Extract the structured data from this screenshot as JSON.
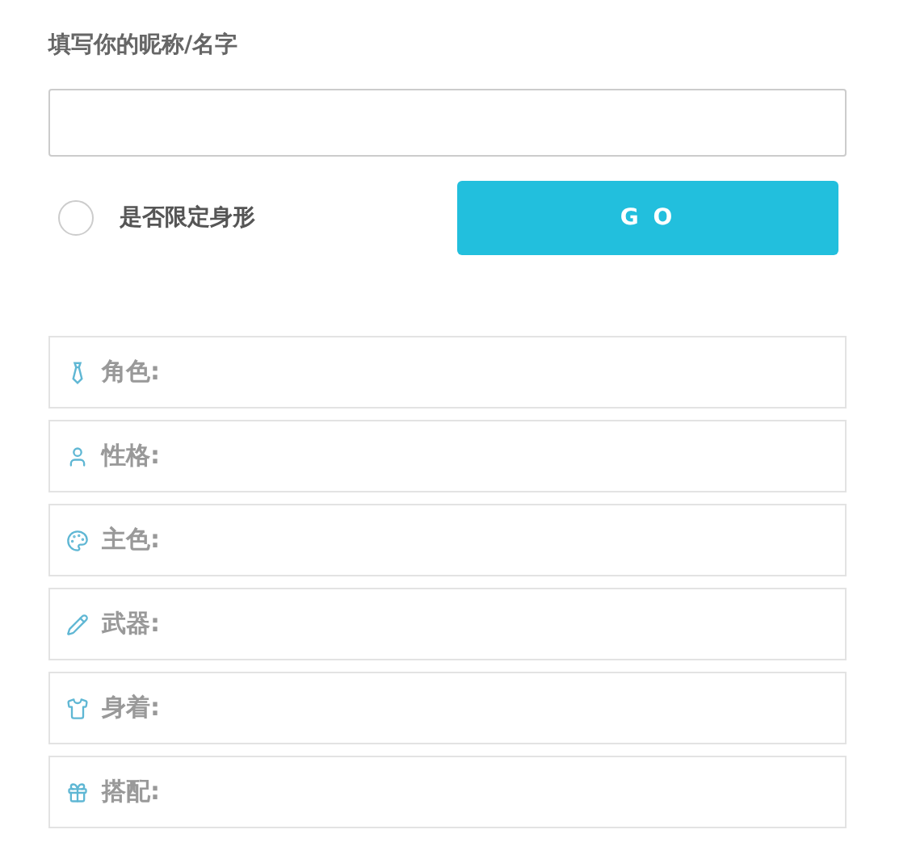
{
  "name_label": "填写你的昵称/名字",
  "limit_option": {
    "label": "是否限定身形",
    "selected": false
  },
  "go_button": {
    "label": "G O"
  },
  "results": [
    {
      "label": "角色:"
    },
    {
      "label": "性格:"
    },
    {
      "label": "主色:"
    },
    {
      "label": "武器:"
    },
    {
      "label": "身着:"
    },
    {
      "label": "搭配:"
    }
  ]
}
